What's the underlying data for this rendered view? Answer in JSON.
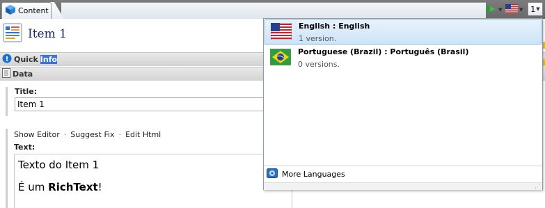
{
  "tab": {
    "label": "Content"
  },
  "toolbar": {
    "version_label": "1"
  },
  "item": {
    "title": "Item 1"
  },
  "sections": {
    "quick_prefix": "Quick",
    "quick_highlight": "Info",
    "data": "Data"
  },
  "fields": {
    "title_label": "Title:",
    "title_value": "Item 1",
    "text_label": "Text:",
    "links": {
      "show_editor": "Show Editor",
      "suggest_fix": "Suggest Fix",
      "edit_html": "Edit Html",
      "separator": "·"
    }
  },
  "richtext": {
    "line1": "Texto do Item 1",
    "line2_prefix": "É um ",
    "line2_bold": "RichText",
    "line2_suffix": "!"
  },
  "languages": [
    {
      "name": "English : English",
      "versions": "1 version.",
      "flag": "us-flag-icon"
    },
    {
      "name": "Portuguese (Brazil) : Português (Brasil)",
      "versions": "0 versions.",
      "flag": "brazil-flag-icon"
    }
  ],
  "footer": {
    "more_languages": "More Languages"
  },
  "colors": {
    "selection": "#cde4f8",
    "title": "#1a2a66",
    "highlight": "#3875d7"
  }
}
